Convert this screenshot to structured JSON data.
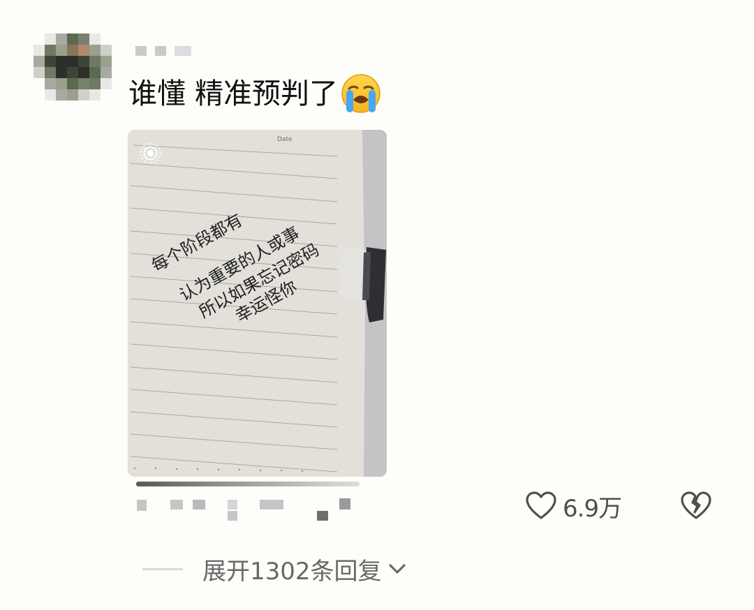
{
  "comment": {
    "username": "",
    "text": "谁懂 精准预判了",
    "emoji": "loudly-crying-face",
    "image": {
      "date_label": "Date",
      "handwriting_lines": [
        "每个阶段都有",
        "认为重要的人或事",
        "所以如果忘记密码",
        "幸运怪你"
      ]
    },
    "likes": "6.9万",
    "expand_replies": "展开1302条回复"
  },
  "colors": {
    "background": "#fdfdf9",
    "text": "#111111",
    "muted": "#686868",
    "icon": "#4f4f4f",
    "paper": "#c8c8ca"
  }
}
